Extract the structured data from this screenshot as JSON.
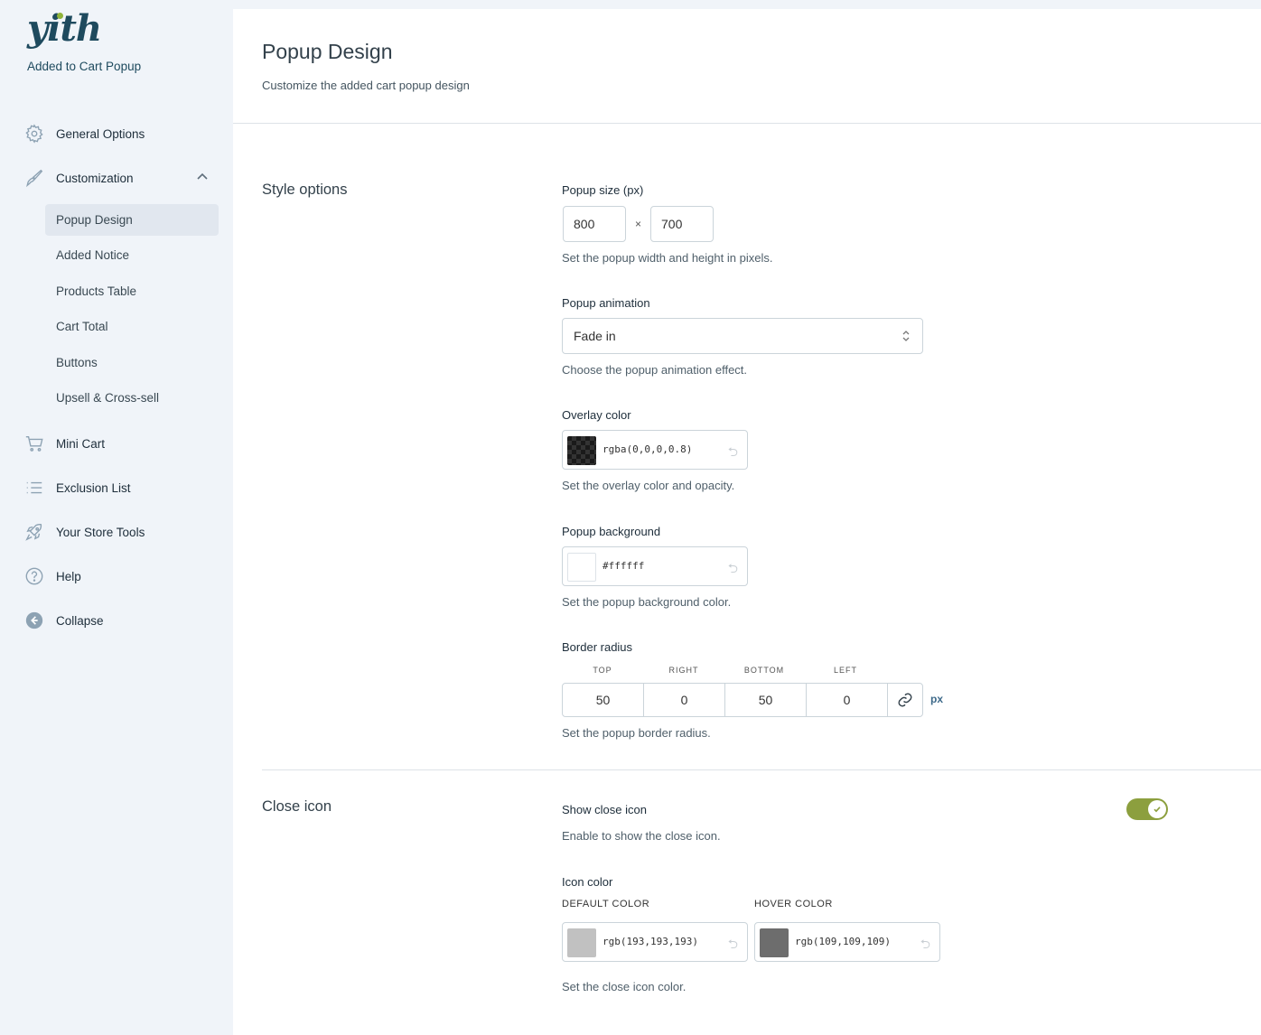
{
  "sidebar": {
    "logo": "yith",
    "plugin_name": "Added to Cart Popup",
    "items": [
      {
        "label": "General Options",
        "icon": "gear-icon"
      },
      {
        "label": "Customization",
        "icon": "brush-icon"
      },
      {
        "label": "Mini Cart",
        "icon": "cart-icon"
      },
      {
        "label": "Exclusion List",
        "icon": "list-icon"
      },
      {
        "label": "Your Store Tools",
        "icon": "rocket-icon"
      },
      {
        "label": "Help",
        "icon": "help-icon"
      },
      {
        "label": "Collapse",
        "icon": "collapse-icon"
      }
    ],
    "sub_items": [
      "Popup Design",
      "Added Notice",
      "Products Table",
      "Cart Total",
      "Buttons",
      "Upsell & Cross-sell"
    ]
  },
  "header": {
    "title": "Popup Design",
    "description": "Customize the added cart popup design"
  },
  "style_options": {
    "section_title": "Style options",
    "popup_size": {
      "label": "Popup size (px)",
      "width": "800",
      "times": "×",
      "height": "700",
      "description": "Set the popup width and height in pixels."
    },
    "popup_animation": {
      "label": "Popup animation",
      "value": "Fade in",
      "description": "Choose the popup animation effect."
    },
    "overlay_color": {
      "label": "Overlay color",
      "value": "rgba(0,0,0,0.8)",
      "description": "Set the overlay color and opacity."
    },
    "popup_background": {
      "label": "Popup background",
      "value": "#ffffff",
      "swatch": "#ffffff",
      "description": "Set the popup background color."
    },
    "border_radius": {
      "label": "Border radius",
      "labels": [
        "TOP",
        "RIGHT",
        "BOTTOM",
        "LEFT"
      ],
      "values": [
        "50",
        "0",
        "50",
        "0"
      ],
      "unit": "px",
      "description": "Set the popup border radius."
    }
  },
  "close_icon": {
    "section_title": "Close icon",
    "show": {
      "label": "Show close icon",
      "description": "Enable to show the close icon.",
      "enabled": true
    },
    "icon_color": {
      "label": "Icon color",
      "default_label": "DEFAULT COLOR",
      "default_value": "rgb(193,193,193)",
      "default_swatch": "#c1c1c1",
      "hover_label": "HOVER COLOR",
      "hover_value": "rgb(109,109,109)",
      "hover_swatch": "#6d6d6d",
      "description": "Set the close icon color."
    }
  },
  "colors": {
    "toggle_on": "#8c9f3e",
    "brand": "#1e4a5e",
    "logo_dot": "#8fb33a"
  }
}
